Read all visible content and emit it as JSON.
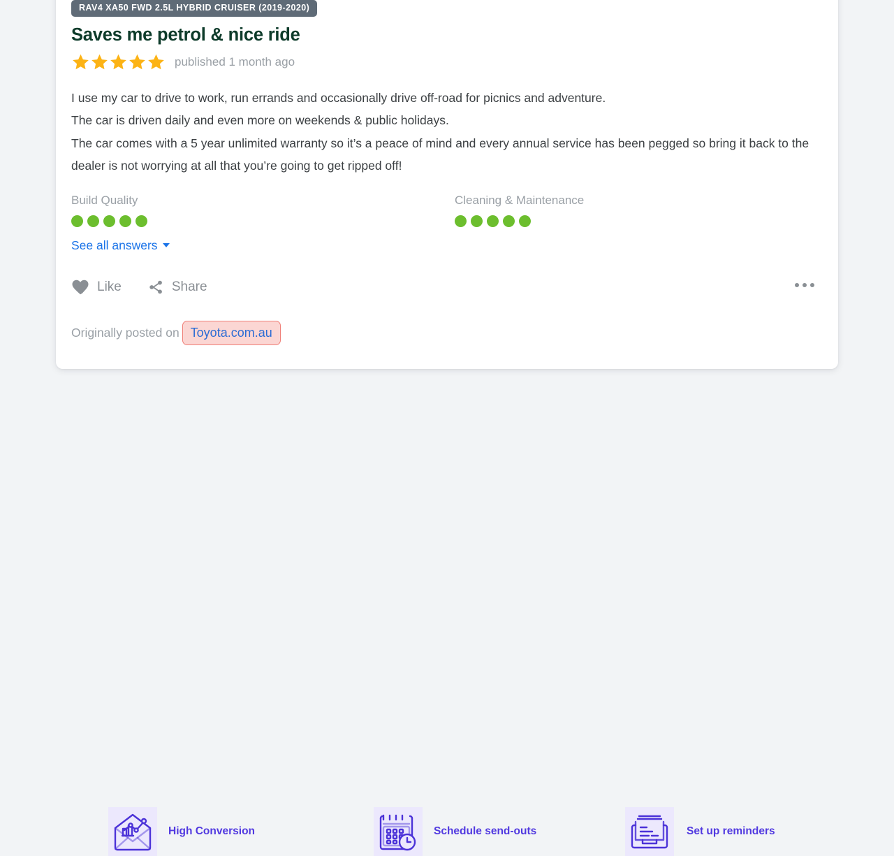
{
  "review": {
    "model_badge": "RAV4 XA50 FWD 2.5L HYBRID CRUISER (2019-2020)",
    "title": "Saves me petrol & nice ride",
    "star_rating": 5,
    "star_color": "#FCB315",
    "published": "published 1 month ago",
    "body_lines": [
      "I use my car to drive to work, run errands and occasionally drive off-road for picnics and adventure.",
      "The car is driven daily and even more on weekends & public holidays.",
      "The car comes with a 5 year unlimited warranty so it’s a peace of mind and every annual service has been pegged so bring it back to the dealer is not worrying at all that you’re going to get ripped off!"
    ],
    "attributes": [
      {
        "label": "Build Quality",
        "dots_filled": 5,
        "dots_total": 5
      },
      {
        "label": "Cleaning & Maintenance",
        "dots_filled": 5,
        "dots_total": 5
      }
    ],
    "dot_color": "#6CBE2E",
    "see_all_answers": "See all answers",
    "actions": {
      "like_label": "Like",
      "share_label": "Share",
      "more_label": "•••"
    },
    "source": {
      "prefix": "Originally posted on",
      "link_text": "Toyota.com.au",
      "link_color": "#2B6CD4",
      "highlight_fill": "#FBD6D3",
      "highlight_border": "#EF7F77"
    },
    "title_color": "#0D3B2A",
    "badge_color": "#5F6B77",
    "link_color": "#1A73E8"
  },
  "features": [
    {
      "label": "High Conversion",
      "icon": "envelope-chart-icon"
    },
    {
      "label": "Schedule send-outs",
      "icon": "calendar-clock-icon"
    },
    {
      "label": "Set up reminders",
      "icon": "document-tray-icon"
    }
  ],
  "theme": {
    "page_background": "#F2F4F6",
    "card_background": "#FFFFFF",
    "feature_accent": "#5139E0",
    "feature_icon_background": "#ECE8FD"
  }
}
